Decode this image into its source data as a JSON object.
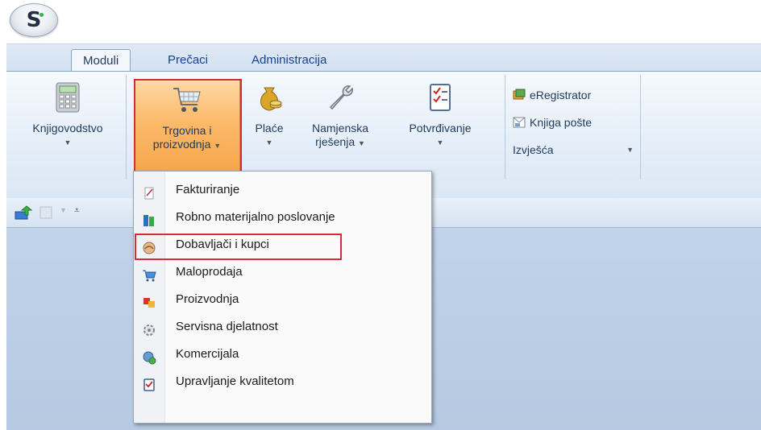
{
  "ribbon_tabs": [
    "Moduli",
    "Prečaci",
    "Administracija"
  ],
  "ribbon": {
    "knjigovodstvo": {
      "label": "Knjigovodstvo"
    },
    "trgovina": {
      "label_line1": "Trgovina i",
      "label_line2": "proizvodnja"
    },
    "place": {
      "label": "Plaće"
    },
    "namjenska": {
      "label_line1": "Namjenska",
      "label_line2": "rješenja"
    },
    "potvrdivanje": {
      "label": "Potvrđivanje"
    },
    "small_items": {
      "eregistrator": "eRegistrator",
      "knjiga_poste": "Knjiga pošte",
      "izvjesca": "Izvješća"
    }
  },
  "dropdown_menu": [
    {
      "label": "Fakturiranje",
      "icon": "invoice-icon"
    },
    {
      "label": "Robno materijalno poslovanje",
      "icon": "inventory-icon"
    },
    {
      "label": "Dobavljači i kupci",
      "icon": "suppliers-icon"
    },
    {
      "label": "Maloprodaja",
      "icon": "retail-cart-icon"
    },
    {
      "label": "Proizvodnja",
      "icon": "production-icon"
    },
    {
      "label": "Servisna djelatnost",
      "icon": "service-icon"
    },
    {
      "label": "Komercijala",
      "icon": "commercial-icon"
    },
    {
      "label": "Upravljanje kvalitetom",
      "icon": "quality-icon"
    }
  ],
  "colors": {
    "highlight_border": "#d32f2f",
    "pressed_button": "#fbb969",
    "workspace": "#bcd0e6"
  }
}
